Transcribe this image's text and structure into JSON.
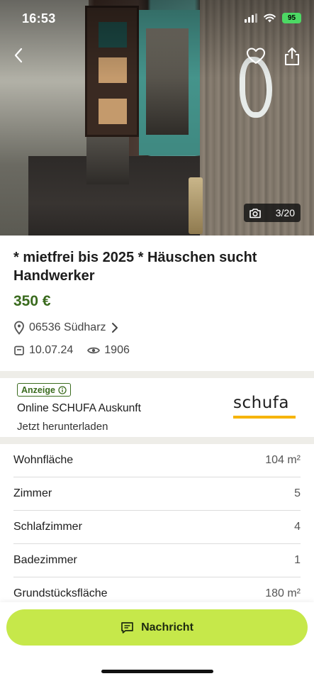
{
  "status_bar": {
    "time": "16:53",
    "battery": "95"
  },
  "gallery": {
    "counter": "3/20"
  },
  "listing": {
    "title": "* mietfrei bis 2025 * Häuschen sucht Handwerker",
    "price": "350 €",
    "location": "06536 Südharz",
    "date": "10.07.24",
    "views": "1906"
  },
  "ad": {
    "badge": "Anzeige",
    "title": "Online SCHUFA Auskunft",
    "subtitle": "Jetzt herunterladen",
    "logo_text": "schufa"
  },
  "details": [
    {
      "label": "Wohnfläche",
      "value": "104 m²"
    },
    {
      "label": "Zimmer",
      "value": "5"
    },
    {
      "label": "Schlafzimmer",
      "value": "4"
    },
    {
      "label": "Badezimmer",
      "value": "1"
    },
    {
      "label": "Grundstücksfläche",
      "value": "180 m²"
    }
  ],
  "cta": {
    "label": "Nachricht"
  },
  "colors": {
    "accent": "#c6e84a",
    "price": "#3a6b1e",
    "schufa_yellow": "#f6b400"
  }
}
